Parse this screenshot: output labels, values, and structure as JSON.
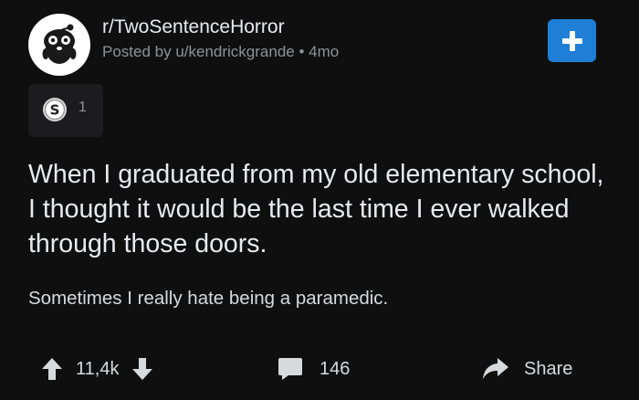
{
  "post": {
    "subreddit": "r/TwoSentenceHorror",
    "posted_by": "Posted by u/kendrickgrande",
    "separator": "•",
    "age": "4mo",
    "award_count": "1",
    "title": "When I graduated from my old elementary school, I thought it would be the last time I ever walked through those doors.",
    "body": "Sometimes I really hate being a paramedic."
  },
  "actions": {
    "votes": "11,4k",
    "comments": "146",
    "share_label": "Share"
  },
  "icons": {
    "join": "plus-icon",
    "award": "silver-award-icon",
    "upvote": "arrow-up-icon",
    "downvote": "arrow-down-icon",
    "comment": "comment-bubble-icon",
    "share": "share-arrow-icon"
  },
  "colors": {
    "background": "#0f0f10",
    "accent": "#1f7fd6",
    "text": "#e8eaed",
    "muted": "#8f9294"
  }
}
